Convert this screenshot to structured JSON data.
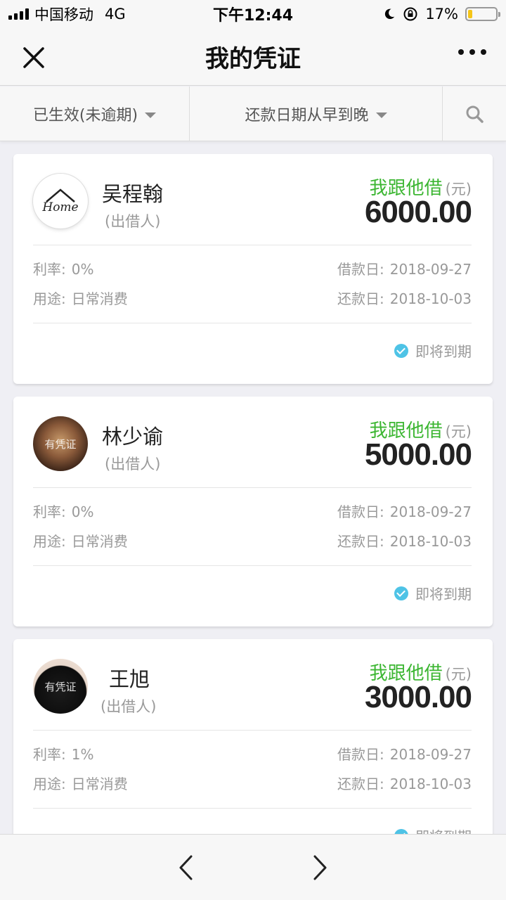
{
  "status_bar": {
    "carrier": "中国移动",
    "network": "4G",
    "time": "下午12:44",
    "battery_text": "17%",
    "battery_level": 0.17
  },
  "nav": {
    "title": "我的凭证",
    "close_icon": "close-icon",
    "more_icon": "more-icon"
  },
  "filters": {
    "status": "已生效(未逾期)",
    "sort": "还款日期从早到晚",
    "search_icon": "search-icon"
  },
  "colors": {
    "accent_green": "#3cb632",
    "status_blue": "#4ec3e6"
  },
  "cards": [
    {
      "name": "吴程翰",
      "role": "(出借人)",
      "direction": "我跟他借",
      "unit": "(元)",
      "amount": "6000.00",
      "rate_label": "利率:",
      "rate": "0%",
      "purpose_label": "用途:",
      "purpose": "日常消费",
      "loan_date_label": "借款日:",
      "loan_date": "2018-09-27",
      "repay_date_label": "还款日:",
      "repay_date": "2018-10-03",
      "status": "即将到期",
      "avatar_text": "Home"
    },
    {
      "name": "林少谕",
      "role": "(出借人)",
      "direction": "我跟他借",
      "unit": "(元)",
      "amount": "5000.00",
      "rate_label": "利率:",
      "rate": "0%",
      "purpose_label": "用途:",
      "purpose": "日常消费",
      "loan_date_label": "借款日:",
      "loan_date": "2018-09-27",
      "repay_date_label": "还款日:",
      "repay_date": "2018-10-03",
      "status": "即将到期",
      "avatar_text": "有凭证"
    },
    {
      "name": "王旭",
      "role": "(出借人)",
      "direction": "我跟他借",
      "unit": "(元)",
      "amount": "3000.00",
      "rate_label": "利率:",
      "rate": "1%",
      "purpose_label": "用途:",
      "purpose": "日常消费",
      "loan_date_label": "借款日:",
      "loan_date": "2018-09-27",
      "repay_date_label": "还款日:",
      "repay_date": "2018-10-03",
      "status": "即将到期",
      "avatar_text": "有凭证"
    }
  ],
  "bottom_bar": {
    "back_icon": "chevron-left-icon",
    "forward_icon": "chevron-right-icon"
  }
}
